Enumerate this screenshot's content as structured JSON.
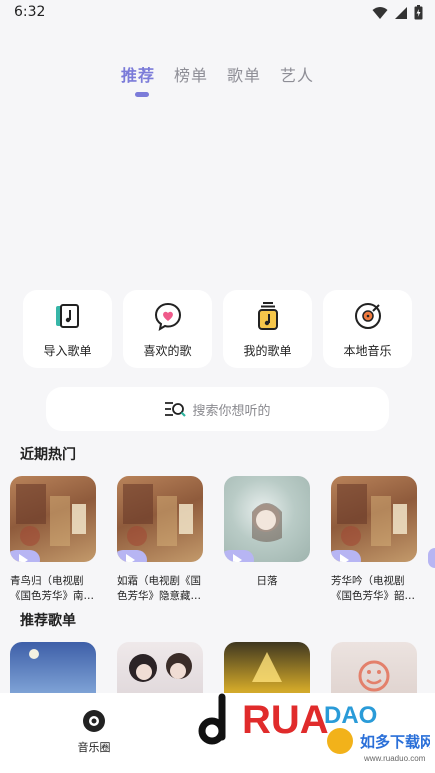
{
  "status_bar": {
    "time": "6:32"
  },
  "tabs": [
    {
      "label": "推荐",
      "active": true
    },
    {
      "label": "榜单",
      "active": false
    },
    {
      "label": "歌单",
      "active": false
    },
    {
      "label": "艺人",
      "active": false
    }
  ],
  "quick_actions": [
    {
      "label": "导入歌单",
      "icon": "import-playlist-icon"
    },
    {
      "label": "喜欢的歌",
      "icon": "heart-chat-icon"
    },
    {
      "label": "我的歌单",
      "icon": "my-playlist-icon"
    },
    {
      "label": "本地音乐",
      "icon": "vinyl-disc-icon"
    }
  ],
  "search": {
    "placeholder": "搜索你想听的"
  },
  "sections": {
    "hot": "近期热门",
    "playlists": "推荐歌单"
  },
  "hot_items": [
    {
      "title": "青鸟归（电视剧《国色芳华》南…"
    },
    {
      "title": "如霜（电视剧《国色芳华》隐意藏…"
    },
    {
      "title": "日落"
    },
    {
      "title": "芳华吟（电视剧《国色芳华》韶…"
    }
  ],
  "bottom_nav": {
    "label": "音乐圈"
  },
  "watermark": {
    "brand": "RUANDAO",
    "text": "如多下载网",
    "url": "www.ruaduo.com"
  },
  "colors": {
    "accent": "#7b7bd9",
    "play_pill": "#b7b5f3",
    "background": "#f6f6f8"
  }
}
